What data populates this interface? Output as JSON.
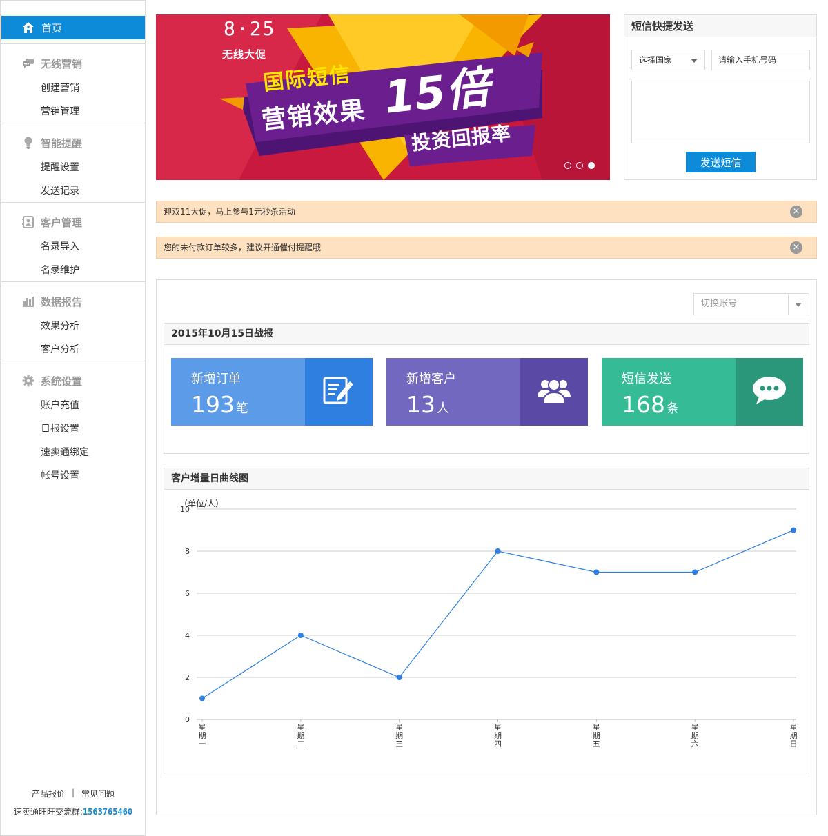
{
  "sidebar": {
    "home": {
      "label": "首页",
      "icon": "home-icon"
    },
    "groups": [
      {
        "title": "无线营销",
        "icon": "chat-bubbles-icon",
        "items": [
          "创建营销",
          "营销管理"
        ]
      },
      {
        "title": "智能提醒",
        "icon": "lightbulb-icon",
        "items": [
          "提醒设置",
          "发送记录"
        ]
      },
      {
        "title": "客户管理",
        "icon": "contact-card-icon",
        "items": [
          "名录导入",
          "名录维护"
        ]
      },
      {
        "title": "数据报告",
        "icon": "bar-chart-icon",
        "items": [
          "效果分析",
          "客户分析"
        ]
      },
      {
        "title": "系统设置",
        "icon": "gear-icon",
        "items": [
          "账户充值",
          "日报设置",
          "速卖通绑定",
          "帐号设置"
        ]
      }
    ],
    "footer": {
      "pricing_link": "产品报价",
      "separator": "|",
      "faq_link": "常见问题",
      "group_label": "速卖通旺旺交流群:",
      "group_number": "1563765460"
    }
  },
  "banner": {
    "date_text": "8·25",
    "promo_label": "无线大促",
    "headline_1": "国际短信",
    "headline_2": "营销效果",
    "multiplier": "15倍",
    "tagline": "投资回报率",
    "slides": 3,
    "active_slide": 3,
    "colors": {
      "background": "#c9193f",
      "ribbon": "#6b1f8f",
      "triangle": "#f8b400"
    }
  },
  "sms": {
    "title": "短信快捷发送",
    "country_select": "选择国家",
    "phone_placeholder": "请输入手机号码",
    "message_value": "",
    "send_button": "发送短信"
  },
  "notices": [
    {
      "text": "迎双11大促，马上参与1元秒杀活动",
      "close": "×"
    },
    {
      "text": "您的未付款订单较多，建议开通催付提醒哦",
      "close": "×"
    }
  ],
  "account_switch": {
    "placeholder": "切换账号"
  },
  "report": {
    "title": "2015年10月15日战报",
    "stats": [
      {
        "label": "新增订单",
        "value": "193",
        "unit": "笔",
        "icon": "edit-document-icon",
        "color_left": "#5b9be8",
        "color_right": "#2f7fe0"
      },
      {
        "label": "新增客户",
        "value": "13",
        "unit": "人",
        "icon": "users-group-icon",
        "color_left": "#7368bf",
        "color_right": "#5a4aa6"
      },
      {
        "label": "短信发送",
        "value": "168",
        "unit": "条",
        "icon": "chat-bubble-icon",
        "color_left": "#35bc97",
        "color_right": "#2a977a"
      }
    ]
  },
  "chart_title": "客户增量日曲线图",
  "chart_data": {
    "type": "line",
    "title": "客户增量日曲线图",
    "unit_label": "（单位/人）",
    "categories": [
      "星期一",
      "星期二",
      "星期三",
      "星期四",
      "星期五",
      "星期六",
      "星期日"
    ],
    "values": [
      1,
      4,
      2,
      8,
      7,
      7,
      9
    ],
    "ylim": [
      0,
      10
    ],
    "yticks": [
      0,
      2,
      4,
      6,
      8,
      10
    ],
    "grid": true,
    "line_color": "#2f7fe0"
  }
}
